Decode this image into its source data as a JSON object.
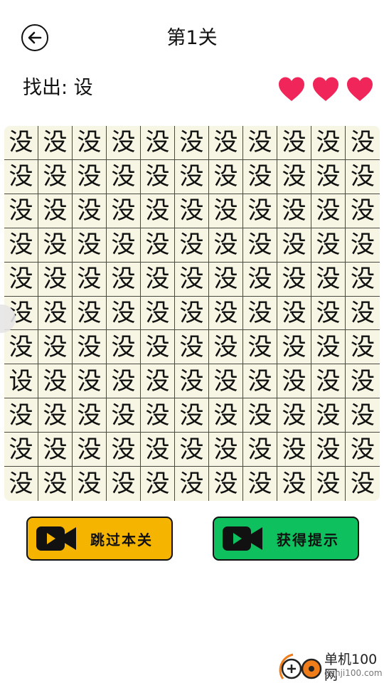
{
  "header": {
    "title": "第1关",
    "back_icon": "arrow-left-icon"
  },
  "target": {
    "label": "找出: 设"
  },
  "lives": {
    "count": 3,
    "color": "#f0265a"
  },
  "grid": {
    "rows": 11,
    "cols": 11,
    "filler_char": "没",
    "odd_char": "设",
    "odd_position": {
      "row": 8,
      "col": 1
    }
  },
  "buttons": {
    "skip_label": "跳过本关",
    "hint_label": "获得提示",
    "skip_color": "#f4b400",
    "hint_color": "#0ec15e",
    "icon": "video-camera-icon"
  },
  "watermark": {
    "text_cn": "单机100网",
    "text_en": "danji100.com"
  }
}
